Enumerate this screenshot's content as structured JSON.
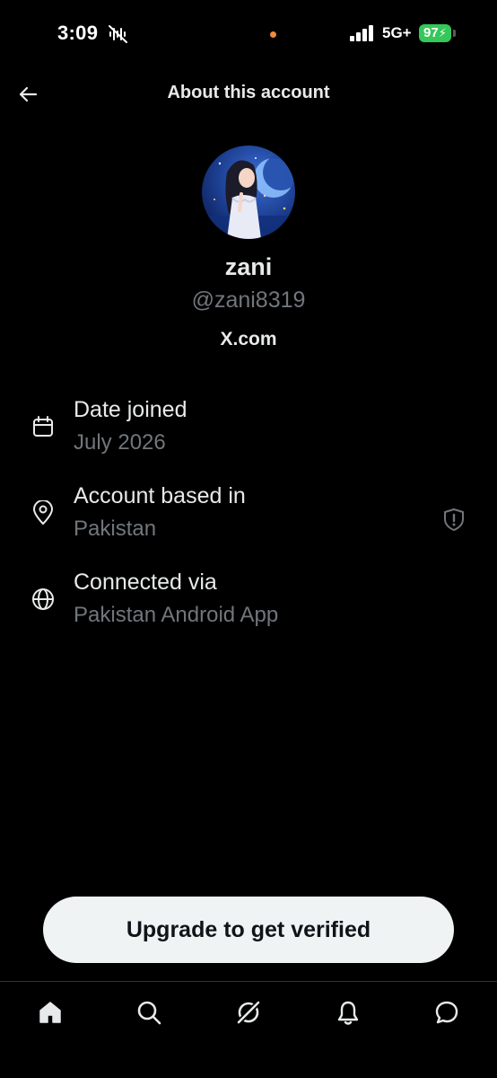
{
  "status_bar": {
    "time": "3:09",
    "network": "5G+",
    "battery": "97",
    "icons": [
      "mute-icon",
      "signal-icon",
      "battery-icon"
    ],
    "privacy_dot_color": "#f08a3c",
    "battery_color": "#34c759"
  },
  "header": {
    "title": "About this account",
    "back_icon": "arrow-left-icon"
  },
  "profile": {
    "display_name": "zani",
    "handle": "@zani8319",
    "site": "X.com"
  },
  "info_rows": [
    {
      "icon": "calendar-icon",
      "label": "Date joined",
      "value": "July 2026"
    },
    {
      "icon": "location-pin-icon",
      "label": "Account based in",
      "value": "Pakistan",
      "badge_icon": "shield-alert-icon"
    },
    {
      "icon": "globe-icon",
      "label": "Connected via",
      "value": "Pakistan Android App"
    }
  ],
  "cta": {
    "label": "Upgrade to get verified"
  },
  "bottom_nav": {
    "items": [
      "home-icon",
      "search-icon",
      "grok-icon",
      "notifications-icon",
      "messages-icon"
    ]
  },
  "colors": {
    "background": "#000000",
    "primary_text": "#e7e9ea",
    "secondary_text": "#71767b",
    "button_bg": "#eff3f4",
    "divider": "#2f3336"
  }
}
